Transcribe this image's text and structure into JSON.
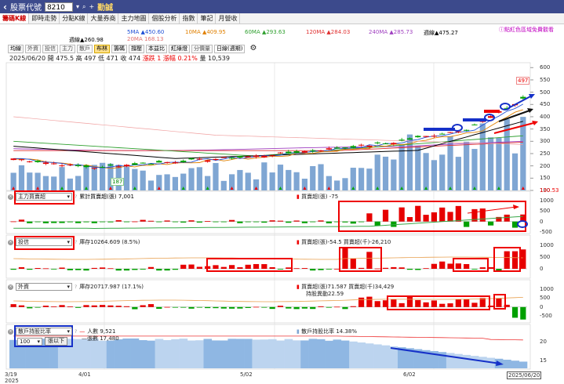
{
  "topbar": {
    "back_glyph": "‹",
    "title": "股票代號",
    "code": "8210",
    "arrow": "▾",
    "search_glyph": "⌕",
    "plus_glyph": "+",
    "name": "勤誠"
  },
  "tabs": [
    "籌碼K線",
    "即時走勢",
    "分點K線",
    "大量券商",
    "主力地圖",
    "個股分析",
    "指數",
    "筆記",
    "月營收"
  ],
  "notice": "ⓘ點紅色區域免費觀看",
  "ma": {
    "ma5": "5MA ▲450.60",
    "ma10": "10MA ▲409.95",
    "ma60": "60MA ▲293.63",
    "ma120": "120MA ▲284.03",
    "ma240": "240MA ▲285.73",
    "ma_up": "週線▲475.27",
    "ma_week": "週線▲260.98",
    "ma20": "20MA 168.13"
  },
  "subtabs": [
    "均線",
    "外資",
    "投信",
    "主力",
    "散戶",
    "布林",
    "籌碼",
    "撐壓",
    "本益比",
    "紅綠燈",
    "分價量"
  ],
  "subtab_select": "日線(週期)",
  "ohlc": {
    "date": "2025/06/20",
    "open": "開 475.5",
    "high": "高 497",
    "low": "低 471",
    "close": "收 474",
    "chg": "漲跌 1",
    "pct": "漲幅 0.21%",
    "vol": "量 10,539"
  },
  "price_axis": [
    "600",
    "550",
    "500",
    "450",
    "400",
    "350",
    "300",
    "250",
    "200",
    "150",
    "100"
  ],
  "price_last": "130.53",
  "price_marks": {
    "high": "497",
    "low": "187"
  },
  "panels": {
    "main_force": {
      "dropdown": "主力買賣超",
      "legend1": "累計買賣超(張) 7,001",
      "legend2": "買賣超(張) -75",
      "axis": [
        "1000",
        "500",
        "0",
        "-500"
      ]
    },
    "trust": {
      "dropdown": "投信",
      "legend1": "庫存10264.609 (8.5%)",
      "legend2": "買賣超(張)-54.5 買賣超(千)-26,210",
      "axis": [
        "1000",
        "500",
        "0"
      ]
    },
    "foreign": {
      "dropdown": "外資",
      "legend1": "庫存20717.987 (17.1%)",
      "legend2": "買賣超(張)71.587 買賣超(千)34,429",
      "legend3": "持股異動22.59",
      "axis": [
        "1000",
        "500",
        "0",
        "-500"
      ]
    },
    "retail": {
      "dropdown": "散戶持股比率",
      "select": "100",
      "btn": "張以下",
      "legend1": "人數 9,521",
      "legend2": "張數 17,480",
      "legend3": "散戶持股比率 14.38%",
      "axis": [
        "20",
        "15"
      ]
    }
  },
  "xdates": [
    "3/19\n2025",
    "4/01",
    "5/02",
    "6/02",
    "2025/06/20"
  ],
  "colors": {
    "up": "#e60000",
    "down": "#00a000",
    "vol": "#7fa6d3",
    "box_red": "#e00000",
    "box_blue": "#1530c8"
  },
  "chart_data": {
    "type": "candlestick",
    "price_range": [
      100,
      620
    ],
    "high": 497,
    "low": 187,
    "last_close": 474,
    "main_force_ylim": [
      -500,
      1000
    ],
    "trust_ylim": [
      -300,
      1000
    ],
    "foreign_ylim": [
      -800,
      1000
    ],
    "retail_ylim": [
      13,
      22
    ]
  }
}
